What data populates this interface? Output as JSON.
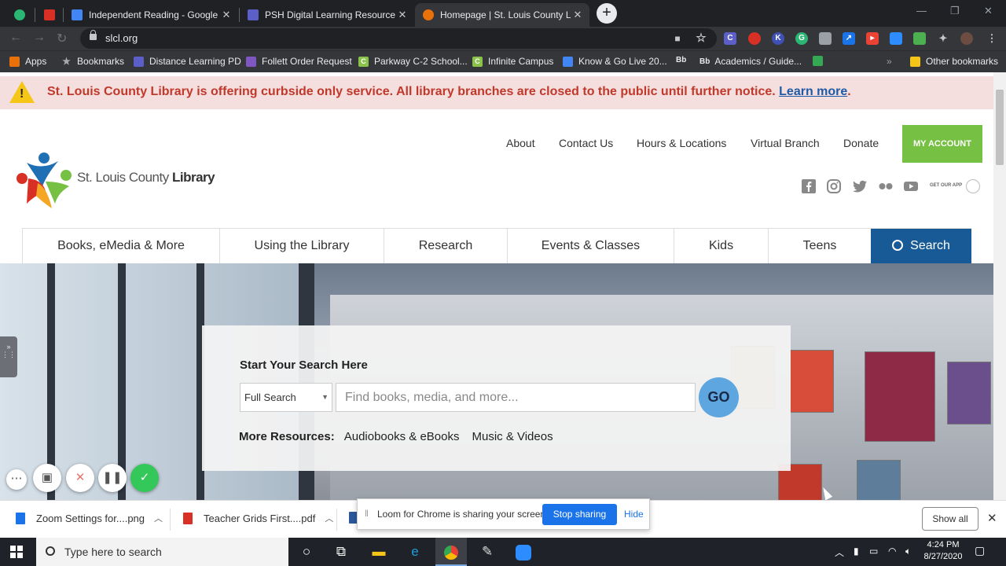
{
  "browser": {
    "tabs": [
      {
        "title": "",
        "favicon_color": "#2bb673"
      },
      {
        "title": "",
        "favicon_color": "#d93025"
      },
      {
        "title": "Independent Reading - Google D",
        "favicon_color": "#4285f4"
      },
      {
        "title": "PSH Digital Learning Resources",
        "favicon_color": "#5b5fc7"
      },
      {
        "title": "Homepage | St. Louis County Libr",
        "favicon_color": "#e8710a"
      }
    ],
    "new_tab_glyph": "+",
    "url": "slcl.org"
  },
  "bookmarks": [
    {
      "label": "Apps",
      "color": "#e8710a"
    },
    {
      "label": "Bookmarks",
      "color": "#888888"
    },
    {
      "label": "Distance Learning PD",
      "color": "#5b5fc7"
    },
    {
      "label": "Follett Order Request",
      "color": "#7e57c2"
    },
    {
      "label": "Parkway C-2 School...",
      "color": "#8bc34a"
    },
    {
      "label": "Infinite Campus",
      "color": "#8bc34a"
    },
    {
      "label": "Know & Go Live 20...",
      "color": "#4285f4"
    },
    {
      "label": "Bb",
      "color": "#333333"
    },
    {
      "label": "Academics / Guide...",
      "color": "#333333"
    },
    {
      "label": "",
      "color": "#34a853"
    },
    {
      "label": "Other bookmarks",
      "color": "#f5c518"
    }
  ],
  "alert": {
    "message": "St. Louis County Library is offering curbside only service. All library branches are closed to the public until further notice.",
    "link": "Learn more",
    "trail": ".",
    "icon": "!"
  },
  "logo": {
    "text_regular": "St. Louis County",
    "text_bold": "Library"
  },
  "top_links": [
    "About",
    "Contact Us",
    "Hours & Locations",
    "Virtual Branch",
    "Donate"
  ],
  "my_account": "MY ACCOUNT",
  "get_app": "GET OUR APP",
  "main_nav": [
    "Books, eMedia & More",
    "Using the Library",
    "Research",
    "Events & Classes",
    "Kids",
    "Teens"
  ],
  "nav_search": "Search",
  "search": {
    "heading": "Start Your Search Here",
    "scope_selected": "Full Search",
    "placeholder": "Find books, media, and more...",
    "go": "GO",
    "more_label": "More Resources:",
    "more_links": [
      "Audiobooks & eBooks",
      "Music & Videos"
    ]
  },
  "downloads": [
    {
      "name": "Zoom Settings for....png",
      "color": "#1a73e8"
    },
    {
      "name": "Teacher Grids First....pdf",
      "color": "#d93025"
    },
    {
      "name": "",
      "color": "#2b579a"
    }
  ],
  "show_all": "Show all",
  "loom": {
    "message": "Loom for Chrome is sharing your screen.",
    "stop": "Stop sharing",
    "hide": "Hide"
  },
  "taskbar": {
    "search_placeholder": "Type here to search",
    "time": "4:24 PM",
    "date": "8/27/2020"
  }
}
